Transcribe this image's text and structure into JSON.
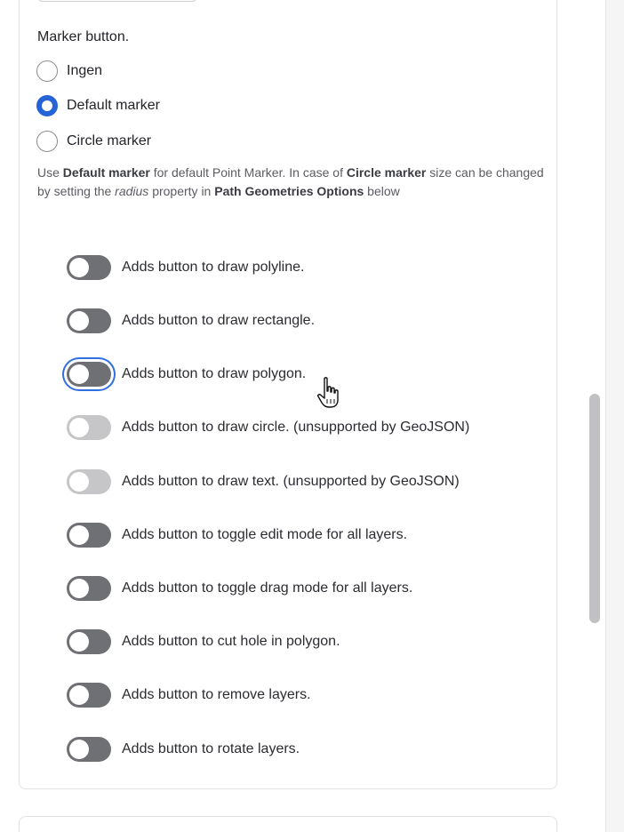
{
  "marker_section": {
    "label": "Marker button.",
    "options": [
      {
        "label": "Ingen",
        "checked": false
      },
      {
        "label": "Default marker",
        "checked": true
      },
      {
        "label": "Circle marker",
        "checked": false
      }
    ],
    "help": {
      "part1": "Use ",
      "bold1": "Default marker",
      "part2": " for default Point Marker. In case of ",
      "bold2": "Circle marker",
      "part3": " size can be changed by setting the ",
      "italic": "radius",
      "part4": " property in ",
      "bold3": "Path Geometries Options",
      "part5": " below"
    }
  },
  "toggles": [
    {
      "label": "Adds button to draw polyline.",
      "state": "off"
    },
    {
      "label": "Adds button to draw rectangle.",
      "state": "off"
    },
    {
      "label": "Adds button to draw polygon.",
      "state": "focused"
    },
    {
      "label": "Adds button to draw circle. (unsupported by GeoJSON)",
      "state": "disabled"
    },
    {
      "label": "Adds button to draw text. (unsupported by GeoJSON)",
      "state": "disabled"
    },
    {
      "label": "Adds button to toggle edit mode for all layers.",
      "state": "off"
    },
    {
      "label": "Adds button to toggle drag mode for all layers.",
      "state": "off"
    },
    {
      "label": "Adds button to cut hole in polygon.",
      "state": "off"
    },
    {
      "label": "Adds button to remove layers.",
      "state": "off"
    },
    {
      "label": "Adds button to rotate layers.",
      "state": "off"
    }
  ],
  "colors": {
    "accent": "#2563d6",
    "switch_off": "#6f7074",
    "switch_disabled": "#c6c6c8"
  },
  "icons": {
    "cursor": "hand-pointer-icon"
  }
}
